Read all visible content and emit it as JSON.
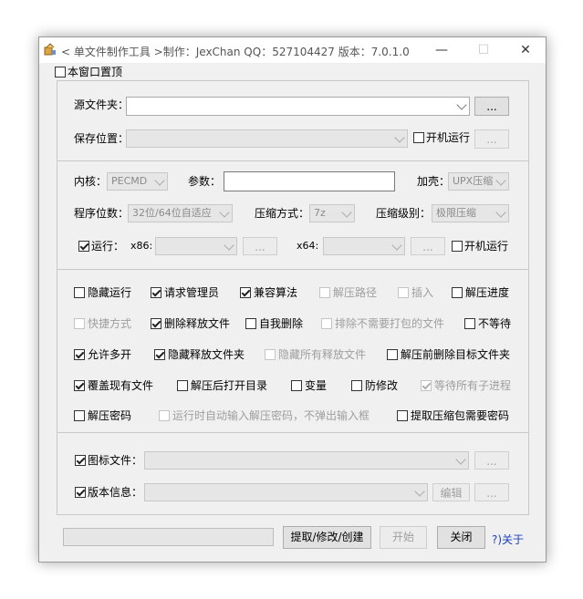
{
  "window": {
    "title": "< 单文件制作工具 >制作：JexChan  QQ：527104427  版本：7.0.1.0",
    "minimize": "—",
    "maximize": "☐",
    "close": "✕"
  },
  "topmost": {
    "label": "本窗口置顶",
    "checked": false
  },
  "paths": {
    "source_label": "源文件夹：",
    "browse_label": "...",
    "save_label": "保存位置：",
    "autorun_label": "开机运行",
    "save_browse_label": "..."
  },
  "kernel": {
    "kernel_label": "内核：",
    "kernel_value": "PECMD",
    "params_label": "参数：",
    "shell_label": "加壳：",
    "shell_value": "UPX压缩",
    "bits_label": "程序位数：",
    "bits_value": "32位/64位自适应",
    "compress_method_label": "压缩方式：",
    "compress_method_value": "7z",
    "compress_level_label": "压缩级别：",
    "compress_level_value": "极限压缩",
    "run_label": "运行：",
    "x86_label": "x86:",
    "x86_browse": "...",
    "x64_label": "x64:",
    "x64_browse": "...",
    "autorun_label": "开机运行"
  },
  "options": [
    {
      "label": "隐藏运行",
      "checked": false,
      "disabled": false
    },
    {
      "label": "请求管理员",
      "checked": true,
      "disabled": false
    },
    {
      "label": "兼容算法",
      "checked": true,
      "disabled": false
    },
    {
      "label": "解压路径",
      "checked": false,
      "disabled": true
    },
    {
      "label": "插入",
      "checked": false,
      "disabled": true
    },
    {
      "label": "解压进度",
      "checked": false,
      "disabled": false
    },
    {
      "label": "快捷方式",
      "checked": false,
      "disabled": true
    },
    {
      "label": "删除释放文件",
      "checked": true,
      "disabled": false
    },
    {
      "label": "自我删除",
      "checked": false,
      "disabled": false
    },
    {
      "label": "排除不需要打包的文件",
      "checked": false,
      "disabled": true
    },
    {
      "label": "不等待",
      "checked": false,
      "disabled": false
    },
    {
      "label": "允许多开",
      "checked": true,
      "disabled": false
    },
    {
      "label": "隐藏释放文件夹",
      "checked": true,
      "disabled": false
    },
    {
      "label": "隐藏所有释放文件",
      "checked": false,
      "disabled": true
    },
    {
      "label": "解压前删除目标文件夹",
      "checked": false,
      "disabled": false
    },
    {
      "label": "覆盖现有文件",
      "checked": true,
      "disabled": false
    },
    {
      "label": "解压后打开目录",
      "checked": false,
      "disabled": false
    },
    {
      "label": "变量",
      "checked": false,
      "disabled": false
    },
    {
      "label": "防修改",
      "checked": false,
      "disabled": false
    },
    {
      "label": "等待所有子进程",
      "checked": true,
      "disabled": true
    },
    {
      "label": "解压密码",
      "checked": false,
      "disabled": false
    },
    {
      "label": "运行时自动输入解压密码，不弹出输入框",
      "checked": false,
      "disabled": true
    },
    {
      "label": "提取压缩包需要密码",
      "checked": false,
      "disabled": false
    }
  ],
  "resources": {
    "icon_label": "图标文件：",
    "icon_browse": "...",
    "version_label": "版本信息：",
    "edit_label": "编辑",
    "version_browse": "..."
  },
  "footer": {
    "extract_label": "提取/修改/创建",
    "start_label": "开始",
    "close_label": "关闭",
    "about_label": "?)关于"
  }
}
